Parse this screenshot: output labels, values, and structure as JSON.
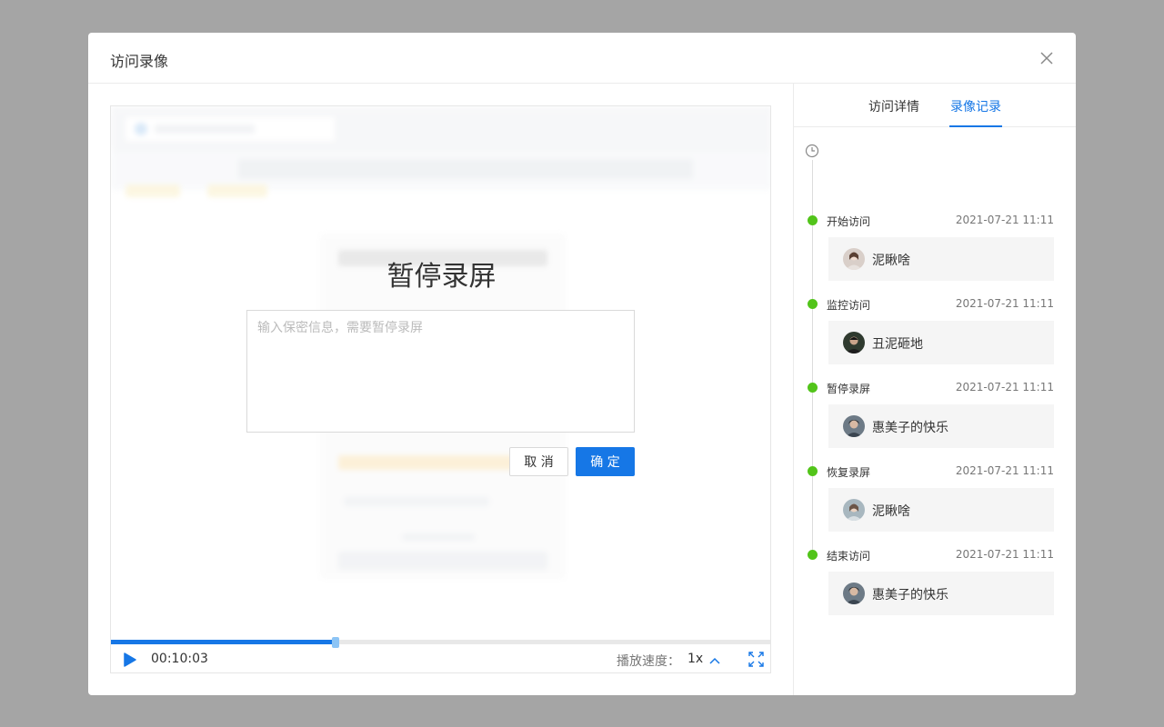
{
  "modal": {
    "title": "访问录像",
    "close_icon": "close-icon"
  },
  "player": {
    "pause_dialog": {
      "title": "暂停录屏",
      "placeholder": "输入保密信息，需要暂停录屏",
      "cancel_label": "取 消",
      "confirm_label": "确 定"
    },
    "progress": {
      "fraction": 0.34
    },
    "current_time": "00:10:03",
    "speed_label": "播放速度：",
    "speed_value": "1x"
  },
  "side": {
    "tabs": [
      {
        "label": "访问详情",
        "active": false
      },
      {
        "label": "录像记录",
        "active": true
      }
    ],
    "events": [
      {
        "label": "开始访问",
        "time": "2021-07-21 11:11",
        "user": "泥瞅啥"
      },
      {
        "label": "监控访问",
        "time": "2021-07-21 11:11",
        "user": "丑泥砸地"
      },
      {
        "label": "暂停录屏",
        "time": "2021-07-21 11:11",
        "user": "惠美子的快乐"
      },
      {
        "label": "恢复录屏",
        "time": "2021-07-21 11:11",
        "user": "泥瞅啥"
      },
      {
        "label": "结束访问",
        "time": "2021-07-21 11:11",
        "user": "惠美子的快乐"
      }
    ]
  },
  "colors": {
    "accent": "#1677e6",
    "timeline_dot": "#52c41a",
    "overlay": "#a5a5a5"
  }
}
